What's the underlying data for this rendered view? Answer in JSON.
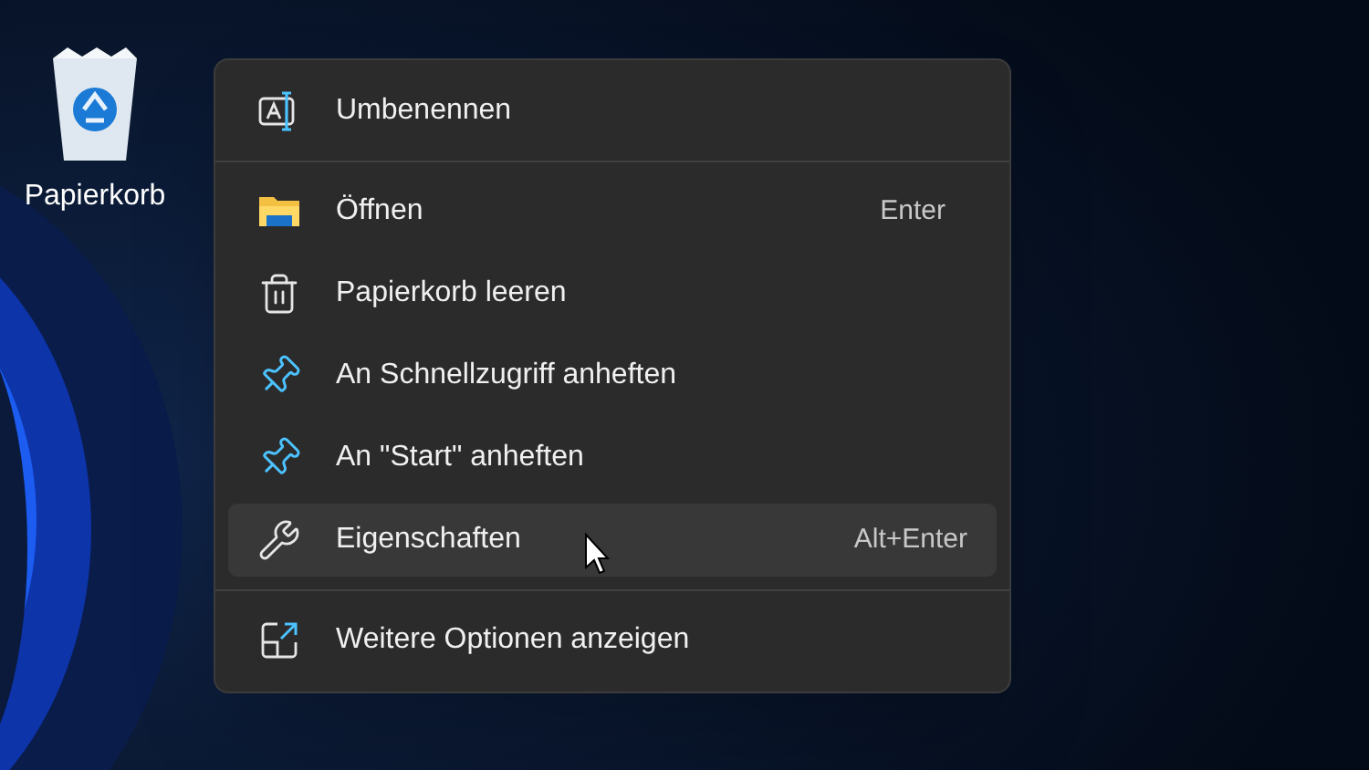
{
  "desktop_icons": [
    {
      "label": "Papierkorb"
    }
  ],
  "context_menu": {
    "sections": [
      [
        {
          "label": "Umbenennen",
          "selected": false
        }
      ],
      [
        {
          "label": "Öffnen",
          "shortcut": "Enter",
          "selected": false
        },
        {
          "label": "Papierkorb leeren",
          "selected": false
        },
        {
          "label": "An Schnellzugriff anheften",
          "selected": false
        },
        {
          "label": "An \"Start\" anheften",
          "selected": false
        },
        {
          "label": "Eigenschaften",
          "shortcut": "Alt+Enter",
          "selected": true
        }
      ],
      [
        {
          "label": "Weitere Optionen anzeigen",
          "selected": false
        }
      ]
    ]
  }
}
